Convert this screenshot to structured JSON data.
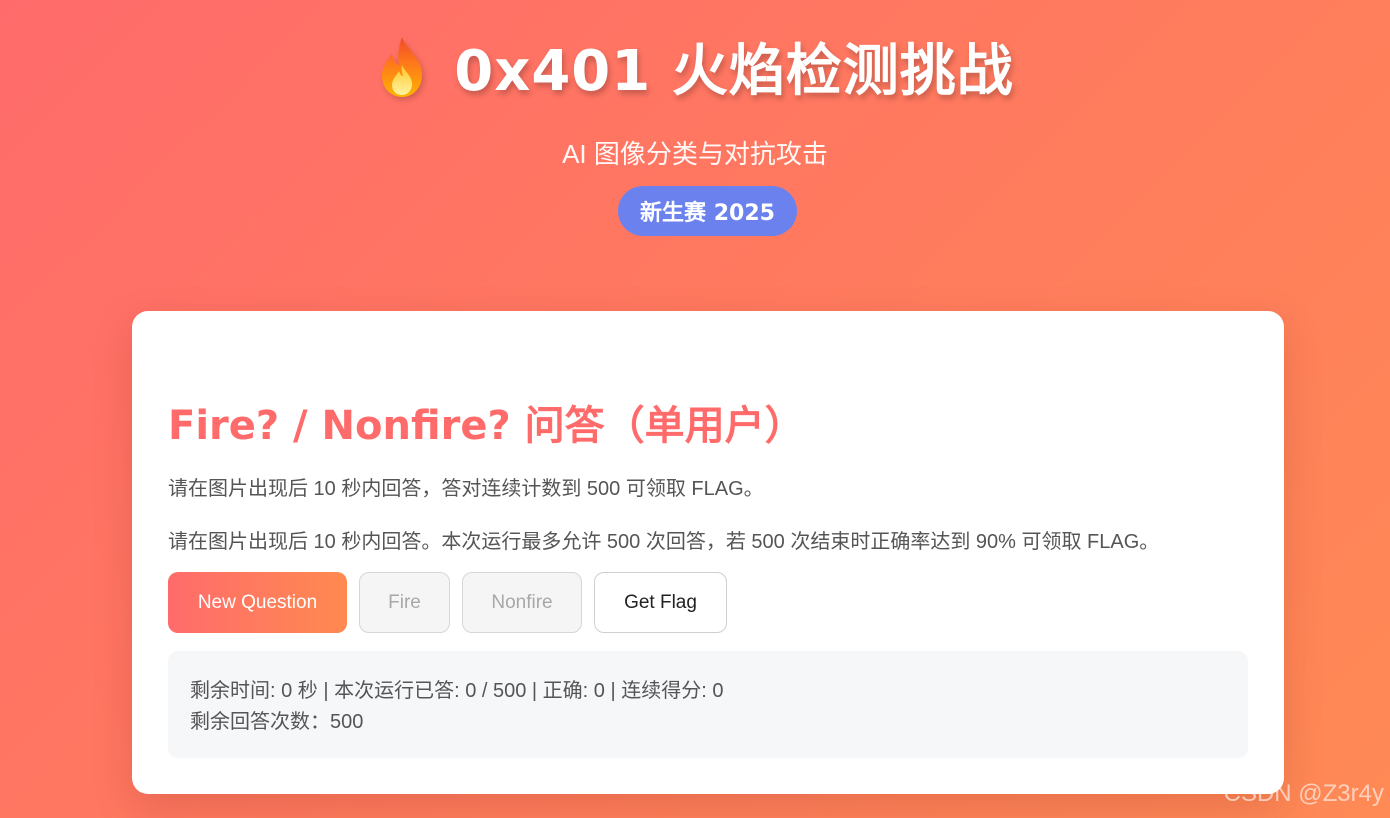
{
  "header": {
    "flame_icon": "fire-icon",
    "title": "0x401 火焰检测挑战",
    "subtitle": "AI 图像分类与对抗攻击",
    "badge": "新生赛 2025"
  },
  "card": {
    "title": "Fire? / Nonfire? 问答（单用户）",
    "desc_1": "请在图片出现后 10 秒内回答，答对连续计数到 500 可领取 FLAG。",
    "desc_2": "请在图片出现后 10 秒内回答。本次运行最多允许 500 次回答，若 500 次结束时正确率达到 90% 可领取 FLAG。",
    "buttons": {
      "new_question": "New Question",
      "fire": "Fire",
      "nonfire": "Nonfire",
      "get_flag": "Get Flag"
    },
    "status": {
      "line_1": "剩余时间: 0 秒 | 本次运行已答: 0 / 500 | 正确: 0 | 连续得分: 0",
      "line_2": "剩余回答次数：500"
    }
  },
  "watermark": "CSDN @Z3r4y",
  "colors": {
    "background_start": "#ff6b6b",
    "background_end": "#ff8a55",
    "badge": "#6b82ee",
    "card_title": "#ff6a6a",
    "primary_button_start": "#ff6b6b",
    "primary_button_end": "#ff8a50"
  }
}
